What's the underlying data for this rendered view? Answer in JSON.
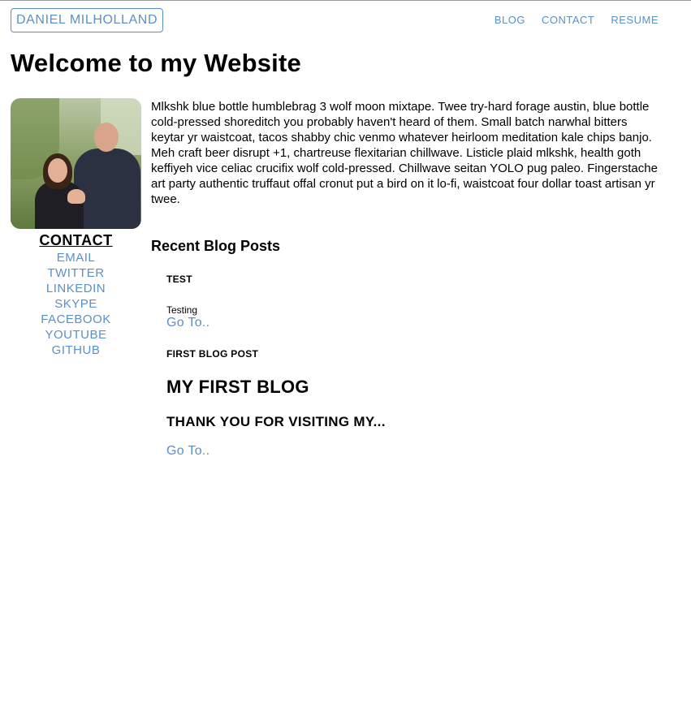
{
  "header": {
    "brand": "DANIEL MILHOLLAND",
    "nav": [
      "BLOG",
      "CONTACT",
      "RESUME"
    ]
  },
  "page": {
    "title": "Welcome to my Website",
    "intro": "Mlkshk blue bottle humblebrag 3 wolf moon mixtape. Twee try-hard forage austin, blue bottle cold-pressed shoreditch you probably haven't heard of them. Small batch narwhal bitters keytar yr waistcoat, tacos shabby chic venmo whatever heirloom meditation kale chips banjo. Meh craft beer disrupt +1, chartreuse flexitarian chillwave. Listicle plaid mlkshk, health goth keffiyeh vice celiac crucifix wolf cold-pressed. Chillwave seitan YOLO pug paleo. Fingerstache art party authentic truffaut offal cronut put a bird on it lo-fi, waistcoat four dollar toast artisan yr twee."
  },
  "contact": {
    "title": "CONTACT",
    "links": [
      "EMAIL",
      "TWITTER",
      "LINKEDIN",
      "SKYPE",
      "FACEBOOK",
      "YOUTUBE",
      "GITHUB"
    ]
  },
  "blog": {
    "heading": "Recent Blog Posts",
    "posts": [
      {
        "title": "TEST",
        "body": "Testing",
        "link": "Go To.."
      },
      {
        "title": "FIRST BLOG POST",
        "heading1": "MY FIRST BLOG",
        "heading2": "THANK YOU FOR VISITING MY...",
        "link": "Go To.."
      }
    ]
  }
}
